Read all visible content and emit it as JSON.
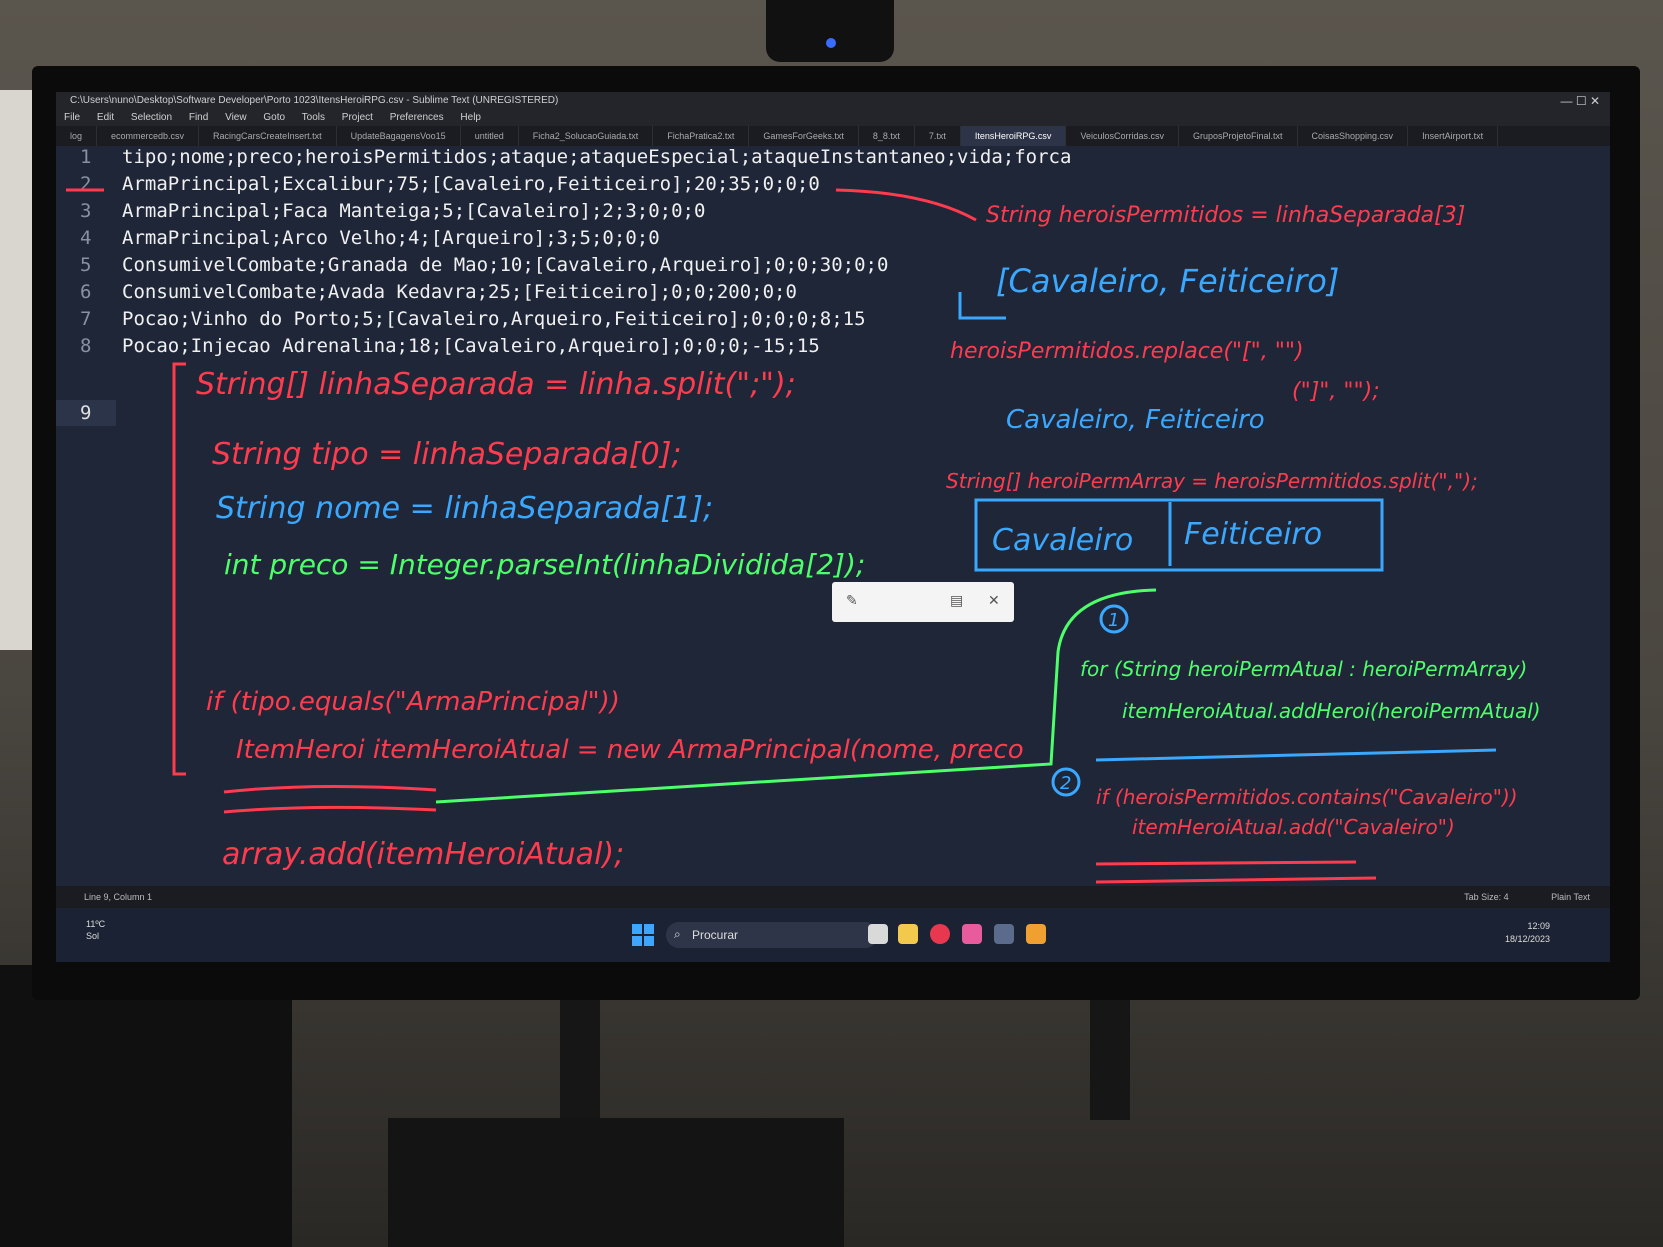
{
  "window": {
    "title": "C:\\Users\\nuno\\Desktop\\Software Developer\\Porto 1023\\ItensHeroiRPG.csv - Sublime Text (UNREGISTERED)",
    "controls": "—  ☐  ✕"
  },
  "menu": [
    "File",
    "Edit",
    "Selection",
    "Find",
    "View",
    "Goto",
    "Tools",
    "Project",
    "Preferences",
    "Help"
  ],
  "tabs": [
    {
      "label": "log"
    },
    {
      "label": "ecommercedb.csv"
    },
    {
      "label": "RacingCarsCreateInsert.txt"
    },
    {
      "label": "UpdateBagagensVoo15"
    },
    {
      "label": "untitled"
    },
    {
      "label": "Ficha2_SolucaoGuiada.txt"
    },
    {
      "label": "FichaPratica2.txt"
    },
    {
      "label": "GamesForGeeks.txt"
    },
    {
      "label": "8_8.txt"
    },
    {
      "label": "7.txt"
    },
    {
      "label": "ItensHeroiRPG.csv",
      "active": true
    },
    {
      "label": "VeiculosCorridas.csv"
    },
    {
      "label": "GruposProjetoFinal.txt"
    },
    {
      "label": "CoisasShopping.csv"
    },
    {
      "label": "InsertAirport.txt"
    }
  ],
  "code_lines": [
    {
      "n": "1",
      "text": "tipo;nome;preco;heroisPermitidos;ataque;ataqueEspecial;ataqueInstantaneo;vida;forca"
    },
    {
      "n": "2",
      "text": "ArmaPrincipal;Excalibur;75;[Cavaleiro,Feiticeiro];20;35;0;0;0"
    },
    {
      "n": "3",
      "text": "ArmaPrincipal;Faca Manteiga;5;[Cavaleiro];2;3;0;0;0"
    },
    {
      "n": "4",
      "text": "ArmaPrincipal;Arco Velho;4;[Arqueiro];3;5;0;0;0"
    },
    {
      "n": "5",
      "text": "ConsumivelCombate;Granada de Mao;10;[Cavaleiro,Arqueiro];0;0;30;0;0"
    },
    {
      "n": "6",
      "text": "ConsumivelCombate;Avada Kedavra;25;[Feiticeiro];0;0;200;0;0"
    },
    {
      "n": "7",
      "text": "Pocao;Vinho do Porto;5;[Cavaleiro,Arqueiro,Feiticeiro];0;0;0;8;15"
    },
    {
      "n": "8",
      "text": "Pocao;Injecao Adrenalina;18;[Cavaleiro,Arqueiro];0;0;0;-15;15"
    },
    {
      "n": "9",
      "text": ""
    }
  ],
  "status": {
    "left": "Line 9, Column 1",
    "tab_size": "Tab Size: 4",
    "syntax": "Plain Text"
  },
  "taskbar": {
    "search": "Procurar",
    "weather_temp": "11ºC",
    "weather_desc": "Sol",
    "time": "12:09",
    "date": "18/12/2023"
  },
  "handwriting": {
    "red_split": "String[] linhaSeparada = linha.split(\";\");",
    "red_tipo": "String tipo = linhaSeparada[0];",
    "blue_nome": "String nome = linhaSeparada[1];",
    "green_preco": "int preco = Integer.parseInt(linhaDividida[2]);",
    "red_if": "if (tipo.equals(\"ArmaPrincipal\"))",
    "red_new": "ItemHeroi itemHeroiAtual = new ArmaPrincipal(nome, preco",
    "red_array_add": "array.add(itemHeroiAtual);",
    "red_herois_permitidos": "String heroisPermitidos = linhaSeparada[3]",
    "blue_bracket": "[Cavaleiro, Feiticeiro]",
    "red_replace_1": "heroisPermitidos.replace(\"[\", \"\")",
    "red_replace_2": "(\"]\", \"\");",
    "blue_cav_feit": "Cavaleiro, Feiticeiro",
    "red_split_array": "String[] heroiPermArray = heroisPermitidos.split(\",\");",
    "blue_box_1": "Cavaleiro",
    "blue_box_2": "Feiticeiro",
    "blue_num_1": "1",
    "green_for": "for (String heroiPermAtual : heroiPermArray)",
    "green_add": "itemHeroiAtual.addHeroi(heroiPermAtual)",
    "blue_num_2": "2",
    "red_if_contains": "if (heroisPermitidos.contains(\"Cavaleiro\"))",
    "red_add_cav": "itemHeroiAtual.add(\"Cavaleiro\")"
  },
  "colors": {
    "red": "#ff3b4e",
    "blue": "#3aa8ff",
    "green": "#4dff6a",
    "editor_bg": "#1f2638"
  }
}
